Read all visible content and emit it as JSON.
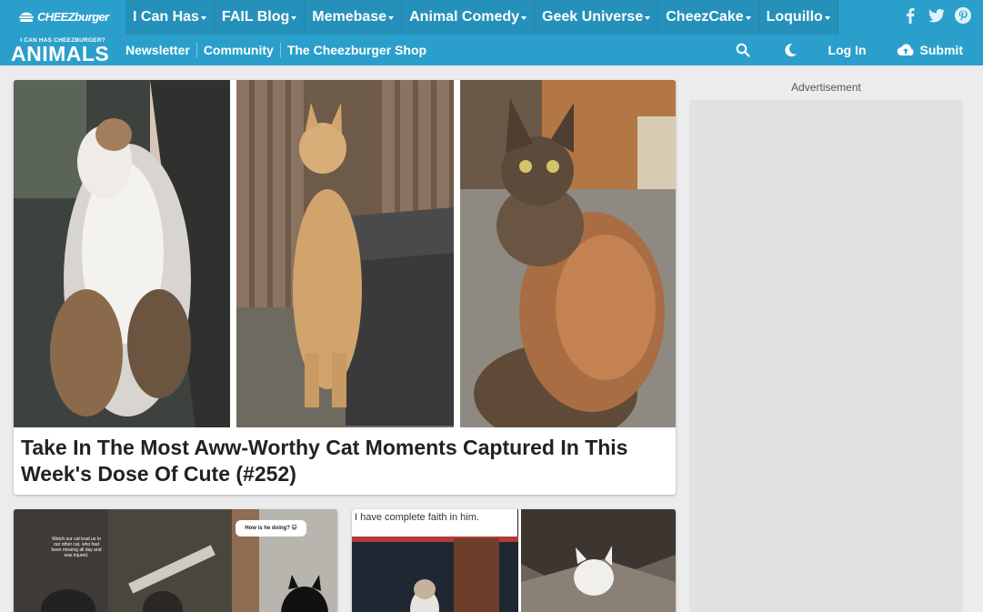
{
  "brand": {
    "network_logo": "CHEEZburger",
    "site_tagline": "I CAN HAS CHEEZBURGER?",
    "site_name": "ANIMALS"
  },
  "network_nav": [
    {
      "label": "I Can Has",
      "name": "nav-i-can-has"
    },
    {
      "label": "FAIL Blog",
      "name": "nav-fail-blog"
    },
    {
      "label": "Memebase",
      "name": "nav-memebase"
    },
    {
      "label": "Animal Comedy",
      "name": "nav-animal-comedy"
    },
    {
      "label": "Geek Universe",
      "name": "nav-geek-universe"
    },
    {
      "label": "CheezCake",
      "name": "nav-cheezcake"
    },
    {
      "label": "Loquillo",
      "name": "nav-loquillo"
    }
  ],
  "social": [
    "facebook-icon",
    "twitter-icon",
    "pinterest-icon"
  ],
  "sub_nav": [
    "Newsletter",
    "Community",
    "The Cheezburger Shop"
  ],
  "tools": {
    "login": "Log In",
    "submit": "Submit"
  },
  "feature": {
    "title": "Take In The Most Aww-Worthy Cat Moments Captured In This Week's Dose Of Cute (#252)"
  },
  "cards": [
    {
      "overlay_texts": [
        "Watch our cat lead us to our other cat, who had been missing all day and was injured.",
        "How is he doing? 😺"
      ]
    },
    {
      "caption": "I have complete faith in him."
    }
  ],
  "sidebar": {
    "ad_label": "Advertisement"
  },
  "colors": {
    "nav_primary": "#2b9fcb",
    "nav_dark": "#2591ba",
    "page_bg": "#ececec"
  }
}
